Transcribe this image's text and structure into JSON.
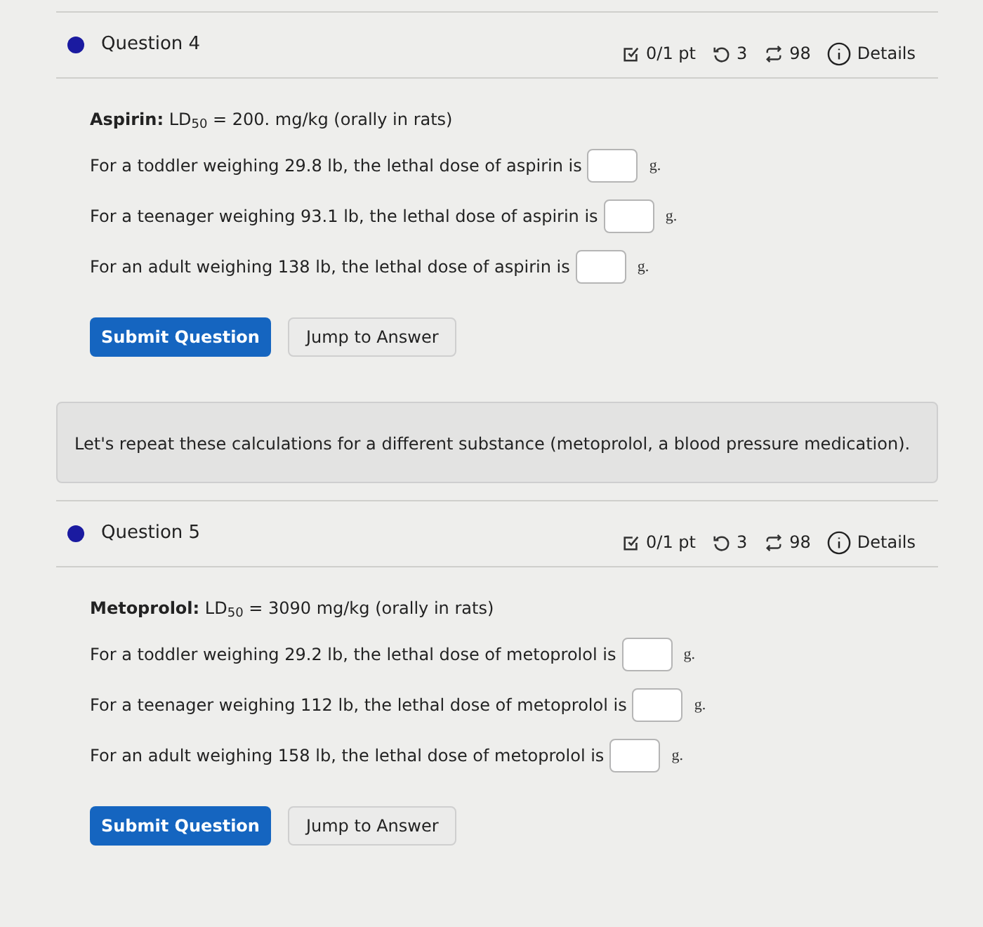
{
  "sections": [
    {
      "kind": "question",
      "title": "Question 4",
      "score": "0/1 pt",
      "retries": "3",
      "submissions": "98",
      "details": "Details",
      "intro": "**Aspirin:** LD$_{50}$ = 200. mg/kg (orally in rats)",
      "parts": [
        {
          "prompt": "For a toddler weighing 29.8 lb, the lethal dose of aspirin is",
          "unit": "g."
        },
        {
          "prompt": "For a teenager weighing 93.1 lb, the lethal dose of aspirin is",
          "unit": "g."
        },
        {
          "prompt": "For an adult weighing 138 lb, the lethal dose of aspirin is",
          "unit": "g."
        }
      ],
      "submit": "Submit Question",
      "jump": "Jump to Answer"
    },
    {
      "kind": "note",
      "text": "Let's repeat these calculations for a different substance (metoprolol, a blood pressure medication)."
    },
    {
      "kind": "question",
      "title": "Question 5",
      "score": "0/1 pt",
      "retries": "3",
      "submissions": "98",
      "details": "Details",
      "intro": "**Metoprolol:** LD$_{50}$ = 3090 mg/kg (orally in rats)",
      "parts": [
        {
          "prompt": "For a toddler weighing 29.2 lb, the lethal dose of metoprolol is",
          "unit": "g."
        },
        {
          "prompt": "For a teenager weighing 112 lb, the lethal dose of metoprolol is",
          "unit": "g."
        },
        {
          "prompt": "For an adult weighing 158 lb, the lethal dose of metoprolol is",
          "unit": "g."
        }
      ],
      "submit": "Submit Question",
      "jump": "Jump to Answer"
    }
  ]
}
